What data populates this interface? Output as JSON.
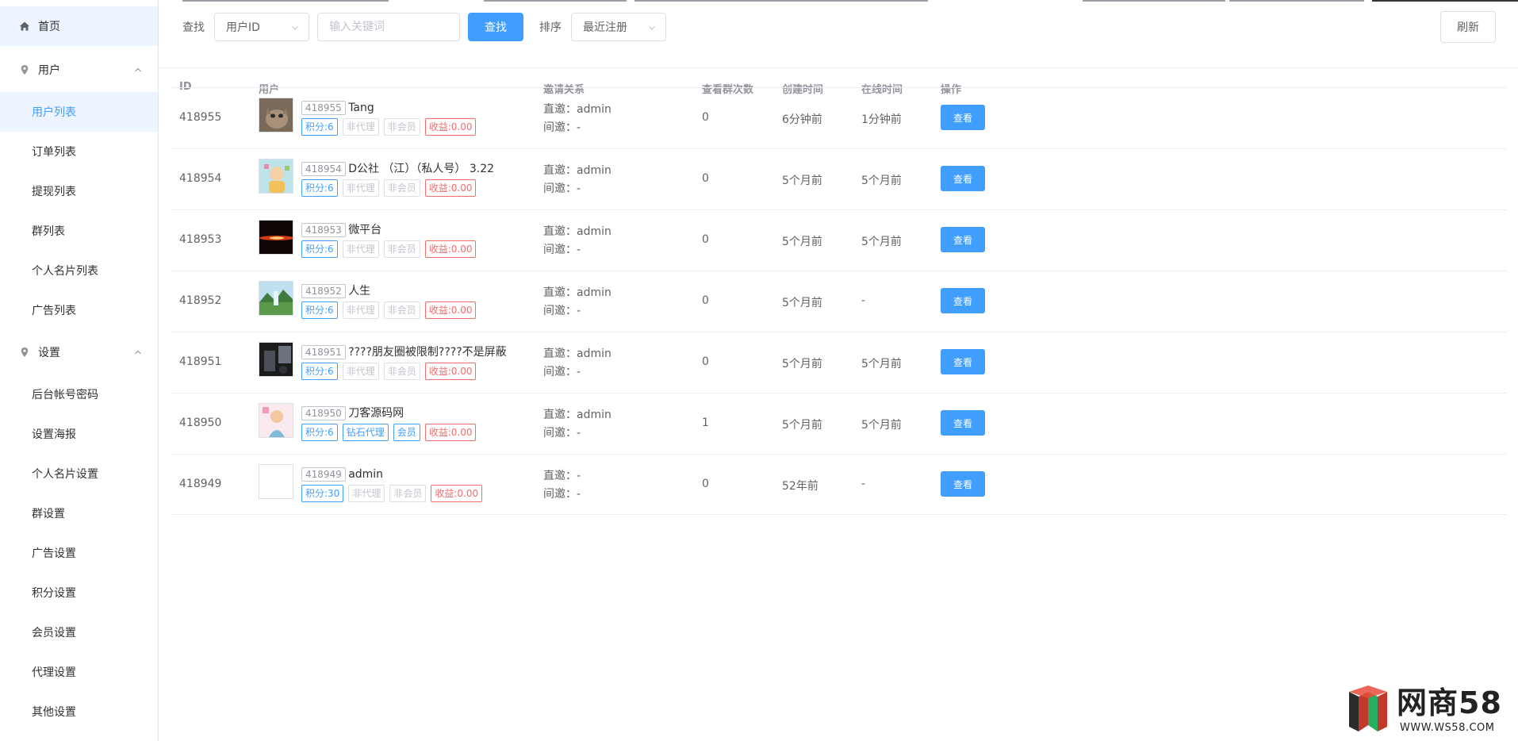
{
  "sidebar": {
    "home": "首页",
    "user_group": "用户",
    "user_items": [
      "用户列表",
      "订单列表",
      "提现列表",
      "群列表",
      "个人名片列表",
      "广告列表"
    ],
    "settings_group": "设置",
    "settings_items": [
      "后台帐号密码",
      "设置海报",
      "个人名片设置",
      "群设置",
      "广告设置",
      "积分设置",
      "会员设置",
      "代理设置",
      "其他设置"
    ],
    "current": "用户列表"
  },
  "toolbar": {
    "search_label": "查找",
    "search_field": "用户ID",
    "keyword_placeholder": "输入关键词",
    "search_button": "查找",
    "sort_label": "排序",
    "sort_value": "最近注册",
    "refresh_button": "刷新"
  },
  "table": {
    "columns": [
      "ID",
      "用户",
      "邀请关系",
      "查看群次数",
      "创建时间",
      "在线时间",
      "操作"
    ],
    "direct_label": "直邀：",
    "indirect_label": "间邀：",
    "rows": [
      {
        "id": "418955",
        "uid_tag": "418955",
        "name": "Tang",
        "points": "积分:6",
        "agent": "非代理",
        "member": "非会员",
        "income": "收益:0.00",
        "direct": "admin",
        "indirect": "-",
        "views": "0",
        "created": "6分钟前",
        "online": "1分钟前",
        "action": "查看"
      },
      {
        "id": "418954",
        "uid_tag": "418954",
        "name": "D公社 （江）（私人号） 3.22",
        "points": "积分:6",
        "agent": "非代理",
        "member": "非会员",
        "income": "收益:0.00",
        "direct": "admin",
        "indirect": "-",
        "views": "0",
        "created": "5个月前",
        "online": "5个月前",
        "action": "查看"
      },
      {
        "id": "418953",
        "uid_tag": "418953",
        "name": "微平台",
        "points": "积分:6",
        "agent": "非代理",
        "member": "非会员",
        "income": "收益:0.00",
        "direct": "admin",
        "indirect": "-",
        "views": "0",
        "created": "5个月前",
        "online": "5个月前",
        "action": "查看"
      },
      {
        "id": "418952",
        "uid_tag": "418952",
        "name": "人生",
        "points": "积分:6",
        "agent": "非代理",
        "member": "非会员",
        "income": "收益:0.00",
        "direct": "admin",
        "indirect": "-",
        "views": "0",
        "created": "5个月前",
        "online": "-",
        "action": "查看"
      },
      {
        "id": "418951",
        "uid_tag": "418951",
        "name": "????朋友圈被限制????不是屏蔽",
        "points": "积分:6",
        "agent": "非代理",
        "member": "非会员",
        "income": "收益:0.00",
        "direct": "admin",
        "indirect": "-",
        "views": "0",
        "created": "5个月前",
        "online": "5个月前",
        "action": "查看"
      },
      {
        "id": "418950",
        "uid_tag": "418950",
        "name": "刀客源码网",
        "points": "积分:6",
        "agent": "钻石代理",
        "member": "会员",
        "income": "收益:0.00",
        "direct": "admin",
        "indirect": "-",
        "views": "1",
        "created": "5个月前",
        "online": "5个月前",
        "action": "查看"
      },
      {
        "id": "418949",
        "uid_tag": "418949",
        "name": "admin",
        "points": "积分:30",
        "agent": "非代理",
        "member": "非会员",
        "income": "收益:0.00",
        "direct": "-",
        "indirect": "-",
        "views": "0",
        "created": "52年前",
        "online": "-",
        "action": "查看"
      }
    ]
  },
  "watermark": {
    "title": "网商58",
    "url": "WWW.WS58.COM"
  },
  "colors": {
    "primary": "#409eff",
    "danger": "#f56c6c",
    "active_bg": "#ecf5ff"
  }
}
